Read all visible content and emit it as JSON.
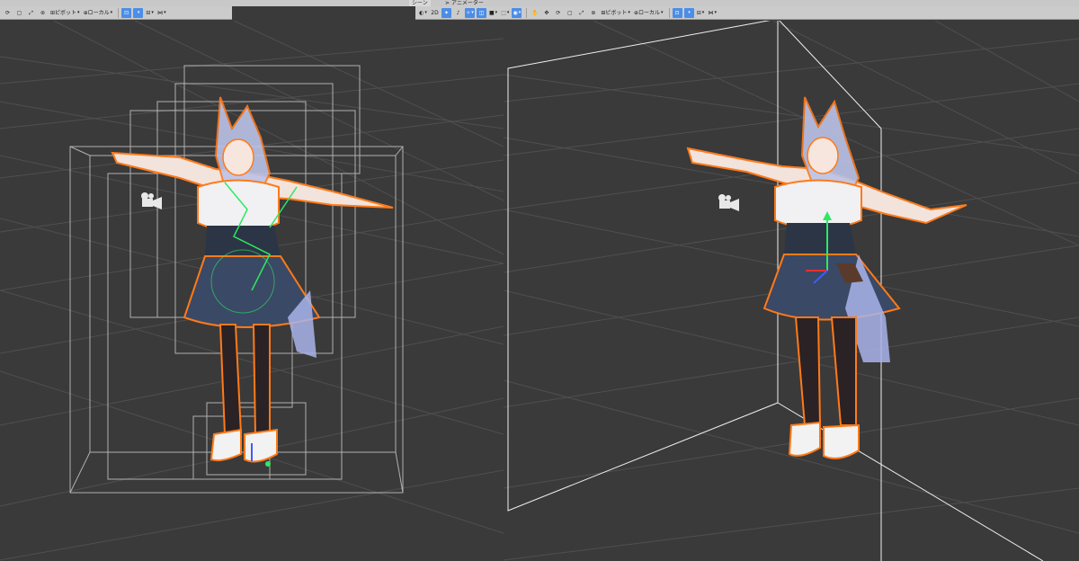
{
  "tabs": {
    "scene": "シーン",
    "animator": "アニメーター"
  },
  "left_toolbar": {
    "pivot_label": "ピボット",
    "local_label": "ローカル"
  },
  "right_toolbar": {
    "mode_2d_label": "2D",
    "pivot_label": "ピボット",
    "local_label": "ローカル"
  },
  "icons": [
    "refresh-icon",
    "rect-tool-icon",
    "scale-tool-icon",
    "transform-tool-icon",
    "light-icon",
    "audio-icon",
    "fx-icon",
    "camera-icon",
    "hand-icon",
    "move-icon",
    "rotate-icon",
    "grid-icon",
    "gizmo-icon",
    "camera-gizmo-icon"
  ],
  "colors": {
    "viewport_bg": "#3a3a3a",
    "grid_line": "#4f4f4f",
    "toolbar_bg": "#cbcbcb",
    "active_button": "#4c8de8",
    "selection_outline": "#ff7a1a",
    "bounds_wire": "#d8d8d8",
    "bone_gizmo": "#2ee860"
  }
}
